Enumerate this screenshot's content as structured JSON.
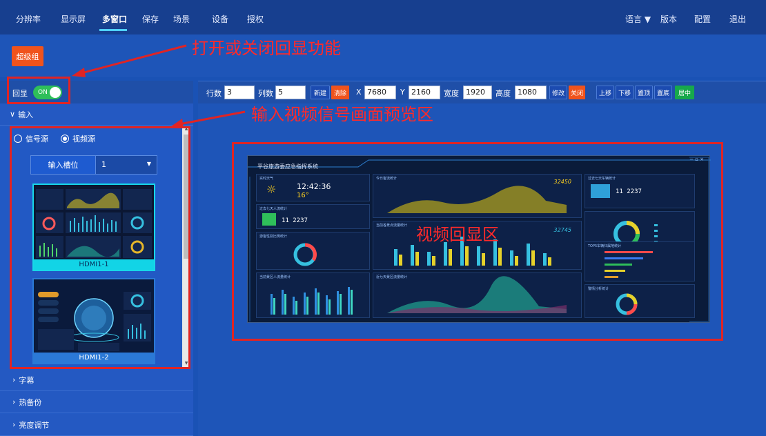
{
  "nav": {
    "items": [
      "分辨率",
      "显示屏",
      "多窗口",
      "保存",
      "场景",
      "设备",
      "授权"
    ],
    "active": "多窗口",
    "right": {
      "language": "语言",
      "version": "版本",
      "config": "配置",
      "exit": "退出"
    }
  },
  "super_group_label": "超级组",
  "annotations": {
    "toggle_callout": "打开或关闭回显功能",
    "preview_callout": "输入视频信号画面预览区",
    "video_callout": "视频回显区"
  },
  "echo": {
    "label": "回显",
    "state": "ON"
  },
  "input_section": {
    "title": "输入",
    "radio_signal": "信号源",
    "radio_video": "视频源",
    "slot_label": "输入槽位",
    "slot_value": "1",
    "thumbs": [
      "HDMI1-1",
      "HDMI1-2"
    ]
  },
  "sections": [
    "字幕",
    "热备份",
    "亮度调节"
  ],
  "controls": {
    "rows_label": "行数",
    "rows": "3",
    "cols_label": "列数",
    "cols": "5",
    "new": "新建",
    "clear": "清除",
    "x_label": "X",
    "x": "7680",
    "y_label": "Y",
    "y": "2160",
    "width_label": "宽度",
    "width": "1920",
    "height_label": "高度",
    "height": "1080",
    "modify": "修改",
    "close": "关闭",
    "up": "上移",
    "down": "下移",
    "top": "置顶",
    "bottom": "置底",
    "center": "居中"
  },
  "dashboard": {
    "title": "平谷旅游委应急指挥系统",
    "time": "12:42:36",
    "temp": "16°",
    "counter1": "32450",
    "counter2": "32745",
    "counter3": "11 2237",
    "p_weather": "实时天气",
    "p_today": "今日客流统计",
    "p_car": "过去七天车辆统计",
    "p_person": "过去七天人流统计",
    "p_scenic": "当前各景点流量统计",
    "p_ratio": "游客性别比例统计",
    "p_top5": "TOP5车辆归属地统计",
    "p_area": "当前景区人流量统计",
    "p_trend": "近七天景区流量统计",
    "p_alarm": "警情分析统计"
  },
  "colors": {
    "accent": "#f0531c",
    "green": "#2fbf5a",
    "cyan": "#12d4e6",
    "navbar": "#173f8f"
  }
}
